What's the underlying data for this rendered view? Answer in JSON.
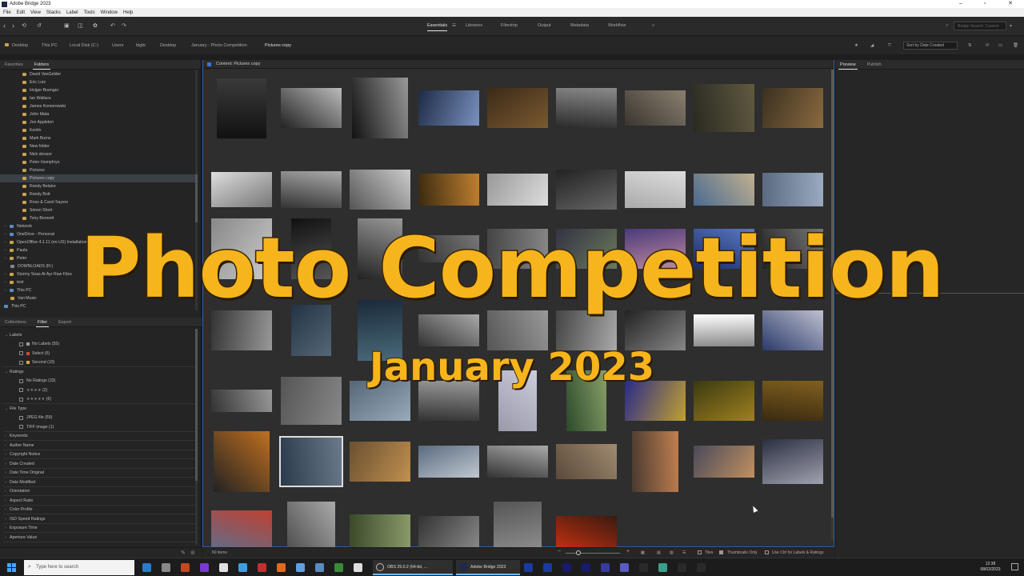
{
  "window": {
    "title": "Adobe Bridge 2023"
  },
  "menu": [
    "File",
    "Edit",
    "View",
    "Stacks",
    "Label",
    "Tools",
    "Window",
    "Help"
  ],
  "workspaces": [
    "Essentials",
    "Libraries",
    "Filmstrip",
    "Output",
    "Metadata",
    "Workflow"
  ],
  "workspace_more": "»",
  "search": {
    "placeholder": "Bridge Search: Current"
  },
  "breadcrumb": [
    "Desktop",
    "This PC",
    "Local Disk (C:)",
    "Users",
    "bigbi",
    "Desktop",
    "January - Photo Competition",
    "Pictures copy"
  ],
  "sort": {
    "label": "Sort by Date Created"
  },
  "left_tabs": [
    "Favorites",
    "Folders"
  ],
  "folders": [
    {
      "label": "David VanGelder",
      "indent": 1,
      "icon": "folder"
    },
    {
      "label": "Eric Lutz",
      "indent": 1,
      "icon": "folder"
    },
    {
      "label": "Holger Buenger",
      "indent": 1,
      "icon": "folder"
    },
    {
      "label": "Ian Wallace",
      "indent": 1,
      "icon": "folder"
    },
    {
      "label": "James Komorowski",
      "indent": 1,
      "icon": "folder"
    },
    {
      "label": "John Mata",
      "indent": 1,
      "icon": "folder"
    },
    {
      "label": "Jon Appleton",
      "indent": 1,
      "icon": "folder"
    },
    {
      "label": "Kenlin",
      "indent": 1,
      "icon": "folder"
    },
    {
      "label": "Mark Burns",
      "indent": 1,
      "icon": "folder"
    },
    {
      "label": "New folder",
      "indent": 1,
      "icon": "folder"
    },
    {
      "label": "Nick slessor",
      "indent": 1,
      "icon": "folder"
    },
    {
      "label": "Peter Humphrys",
      "indent": 1,
      "icon": "folder"
    },
    {
      "label": "Pictures",
      "indent": 1,
      "icon": "folder"
    },
    {
      "label": "Pictures copy",
      "indent": 1,
      "icon": "folder",
      "selected": true
    },
    {
      "label": "Randy Belaire",
      "indent": 1,
      "icon": "folder"
    },
    {
      "label": "Randy Bott",
      "indent": 1,
      "icon": "folder"
    },
    {
      "label": "Ross & Carol Sayers",
      "indent": 1,
      "icon": "folder"
    },
    {
      "label": "Simon Short",
      "indent": 1,
      "icon": "folder"
    },
    {
      "label": "Tony Bennett",
      "indent": 1,
      "icon": "folder"
    },
    {
      "label": "Network",
      "indent": 0,
      "icon": "blue",
      "arrow": true
    },
    {
      "label": "OneDrive - Personal",
      "indent": 0,
      "icon": "blue",
      "arrow": true
    },
    {
      "label": "OpenOffice 4.1.11 (en-US) Installation Files",
      "indent": 0,
      "icon": "folder",
      "arrow": true
    },
    {
      "label": "Paula",
      "indent": 0,
      "icon": "folder",
      "arrow": true
    },
    {
      "label": "Peter",
      "indent": 0,
      "icon": "folder",
      "arrow": true
    },
    {
      "label": "DOWNLOADS (R:)",
      "indent": 0,
      "icon": "gray"
    },
    {
      "label": "Stormy Seas At Ayr Raw Files",
      "indent": 0,
      "icon": "folder",
      "arrow": true
    },
    {
      "label": "test",
      "indent": 0,
      "icon": "folder",
      "arrow": true
    },
    {
      "label": "This PC",
      "indent": 0,
      "icon": "blue",
      "arrow": true
    },
    {
      "label": "Van Music",
      "indent": 0,
      "icon": "folder"
    },
    {
      "label": "This PC",
      "indent": -1,
      "icon": "blue",
      "arrow": true
    }
  ],
  "filter_tabs": [
    "Collections",
    "Filter",
    "Export"
  ],
  "filters": {
    "labels": {
      "title": "Labels",
      "items": [
        {
          "label": "No Labels",
          "count": "(55)",
          "color": "#9a9a9a"
        },
        {
          "label": "Select",
          "count": "(6)",
          "color": "#d04a3a"
        },
        {
          "label": "Second",
          "count": "(10)",
          "color": "#d8a63a"
        }
      ]
    },
    "ratings": {
      "title": "Ratings",
      "items": [
        {
          "label": "No Ratings",
          "count": "(33)"
        },
        {
          "label": "★★★★",
          "count": "(2)"
        },
        {
          "label": "★★★★★",
          "count": "(6)"
        }
      ]
    },
    "filetype": {
      "title": "File Type",
      "items": [
        {
          "label": "JPEG file",
          "count": "(59)"
        },
        {
          "label": "TIFF image",
          "count": "(1)"
        }
      ]
    },
    "collapsed": [
      "Keywords",
      "Author Name",
      "Copyright Notice",
      "Date Created",
      "Date Time Original",
      "Date Modified",
      "Orientation",
      "Aspect Ratio",
      "Color Profile",
      "ISO Speed Ratings",
      "Exposure Time",
      "Aperture Value"
    ]
  },
  "content": {
    "header": "Content: Pictures copy"
  },
  "status": {
    "items": "60 items",
    "tiles": "Tiles",
    "thumbs_only": "Thumbnails Only",
    "ctrl_hint": "Use Ctrl for Labels & Ratings"
  },
  "right_tabs": [
    "Preview",
    "Publish"
  ],
  "taskbar": {
    "search_placeholder": "Type here to search",
    "apps": [
      {
        "label": "OBS 29.0.2 (64-bit, ..."
      },
      {
        "label": "Adobe Bridge 2023"
      }
    ],
    "time": "12:38",
    "date": "08/02/2023"
  },
  "overlay": {
    "title": "Photo Competition",
    "subtitle": "January 2023"
  },
  "colors": {
    "accent": "#f6b51c",
    "selection": "#2d5fb3"
  }
}
